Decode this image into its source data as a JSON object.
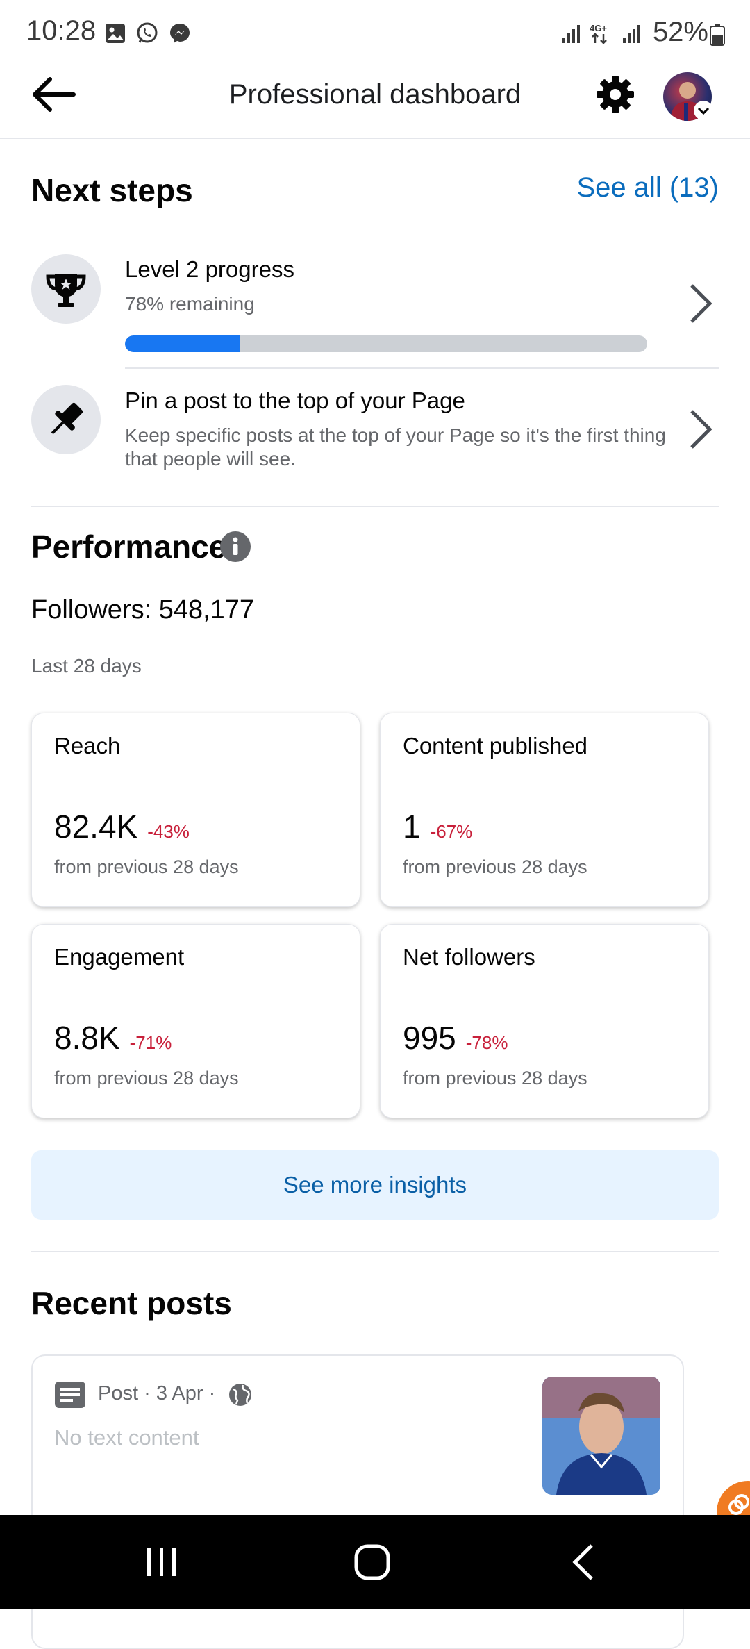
{
  "status_bar": {
    "time": "10:28",
    "battery": "52%"
  },
  "header": {
    "title": "Professional dashboard"
  },
  "next_steps": {
    "title": "Next steps",
    "see_all": "See all (13)",
    "items": [
      {
        "title": "Level 2 progress",
        "subtitle": "78% remaining",
        "progress": 0.22
      },
      {
        "title": "Pin a post to the top of your Page",
        "subtitle": "Keep specific posts at the top of your Page so it's the first thing that people will see."
      }
    ]
  },
  "performance": {
    "title": "Performance",
    "followers": "Followers: 548,177",
    "period": "Last 28 days",
    "cards": [
      {
        "title": "Reach",
        "value": "82.4K",
        "change": "-43%",
        "sub": "from previous 28 days"
      },
      {
        "title": "Content published",
        "value": "1",
        "change": "-67%",
        "sub": "from previous 28 days"
      },
      {
        "title": "Engagement",
        "value": "8.8K",
        "change": "-71%",
        "sub": "from previous 28 days"
      },
      {
        "title": "Net followers",
        "value": "995",
        "change": "-78%",
        "sub": "from previous 28 days"
      }
    ],
    "see_more": "See more insights"
  },
  "recent_posts": {
    "title": "Recent posts",
    "post": {
      "type": "Post",
      "date": "3 Apr",
      "text": "No text content"
    }
  },
  "colors": {
    "accent": "#1877f2",
    "link": "#0a6cbd",
    "negative": "#c8203a"
  }
}
